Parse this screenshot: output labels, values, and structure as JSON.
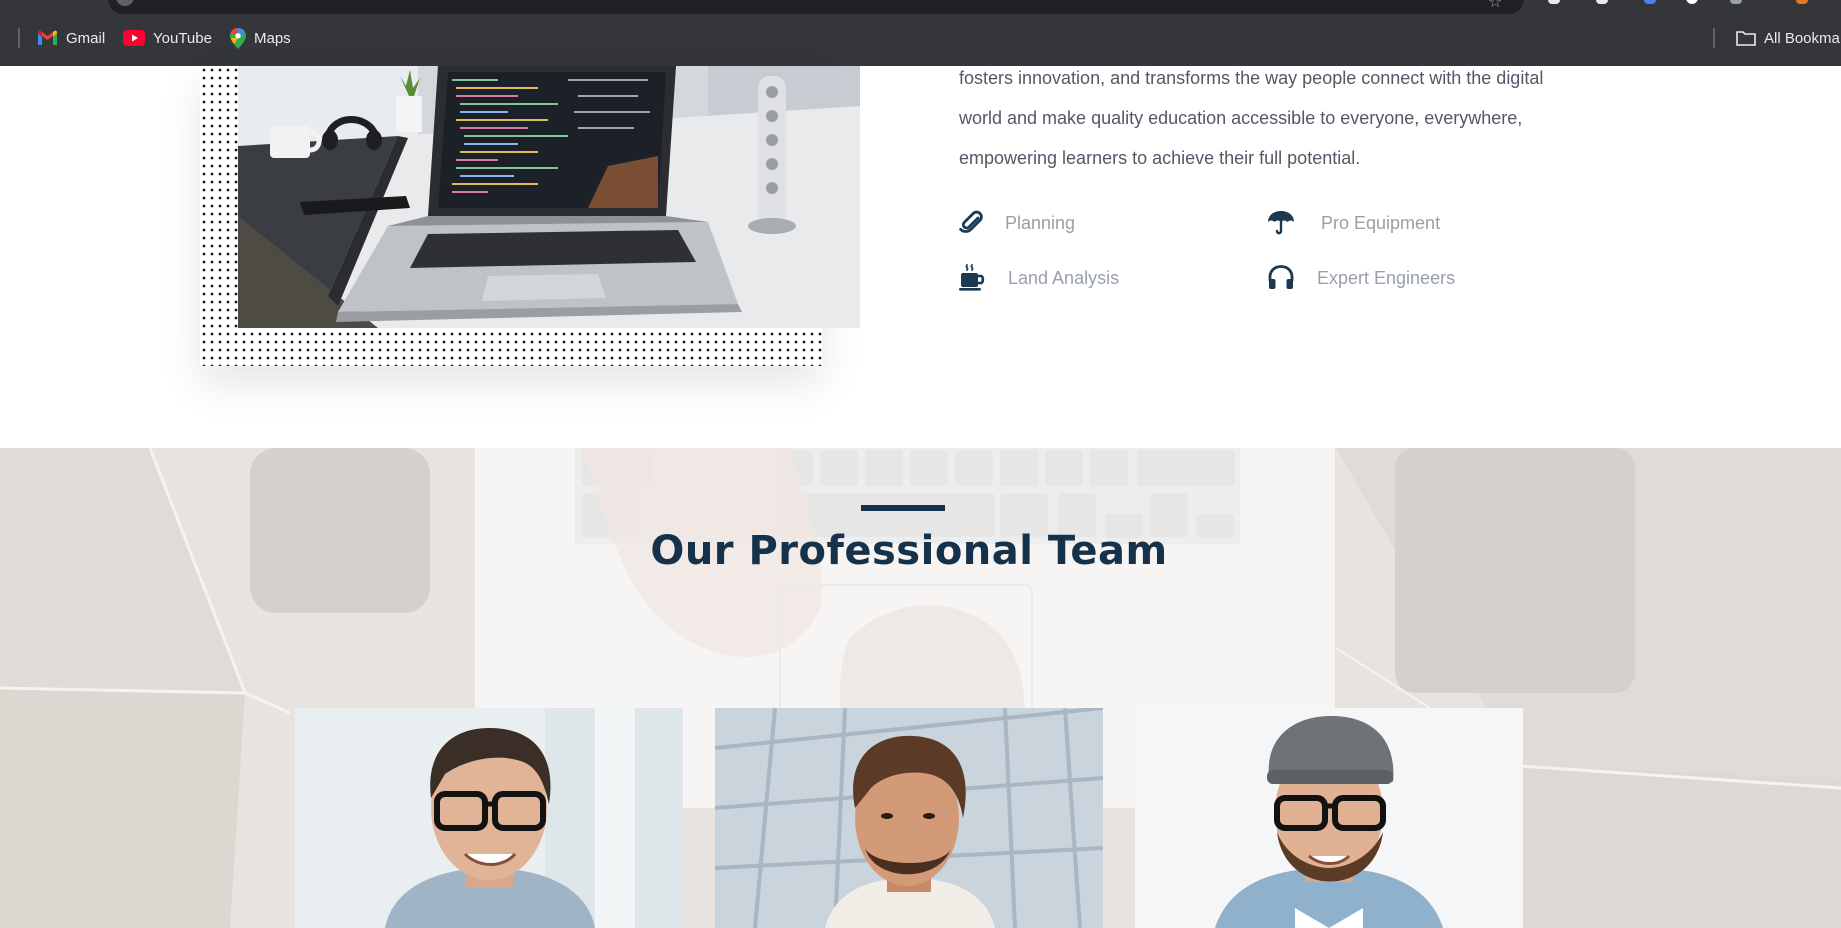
{
  "browser": {
    "bookmarks": [
      {
        "label": "Gmail",
        "icon": "gmail-icon"
      },
      {
        "label": "YouTube",
        "icon": "youtube-icon"
      },
      {
        "label": "Maps",
        "icon": "maps-icon"
      }
    ],
    "all_bookmarks_label": "All Bookma"
  },
  "about": {
    "paragraph_lines": [
      "fosters innovation, and transforms the way people connect with the digital",
      "world and make quality education accessible to everyone, everywhere,",
      "empowering learners to achieve their full potential."
    ],
    "features": [
      {
        "label": "Planning",
        "icon": "paperclip-icon"
      },
      {
        "label": "Pro Equipment",
        "icon": "umbrella-icon"
      },
      {
        "label": "Land Analysis",
        "icon": "coffee-icon"
      },
      {
        "label": "Expert Engineers",
        "icon": "headphones-icon"
      }
    ]
  },
  "team": {
    "title": "Our Professional Team",
    "members": [
      {
        "photo": "team-member-glasses-smiling"
      },
      {
        "photo": "team-member-looking-up"
      },
      {
        "photo": "team-member-beanie-glasses"
      }
    ]
  },
  "colors": {
    "chrome": "#35363a",
    "heading": "#16324a",
    "feature_text": "#98a0ab",
    "body_text": "#525866"
  }
}
